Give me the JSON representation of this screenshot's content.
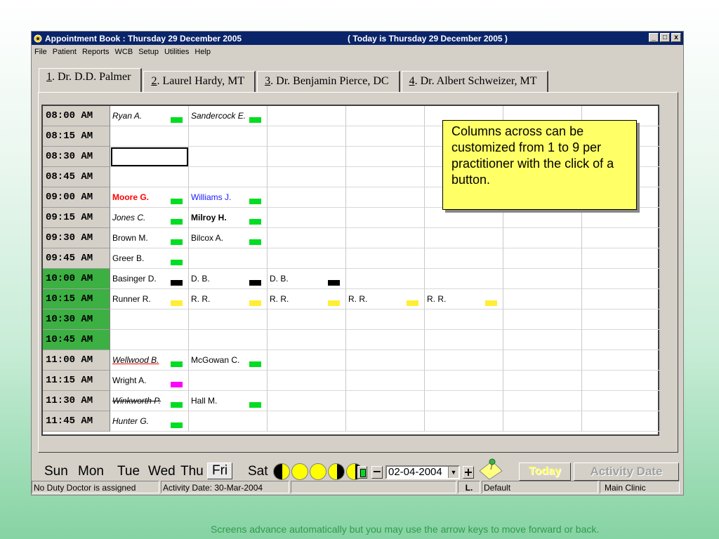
{
  "window": {
    "title": "Appointment Book : Thursday 29 December 2005",
    "today_label": "( Today is Thursday 29 December 2005 )",
    "min_label": "_",
    "max_label": "□",
    "close_label": "x"
  },
  "menu": [
    "File",
    "Patient",
    "Reports",
    "WCB",
    "Setup",
    "Utilities",
    "Help"
  ],
  "tabs": [
    {
      "num": "1",
      "label": ". Dr. D.D. Palmer"
    },
    {
      "num": "2",
      "label": ". Laurel Hardy, MT"
    },
    {
      "num": "3",
      "label": ". Dr. Benjamin Pierce, DC"
    },
    {
      "num": "4",
      "label": ". Dr. Albert Schweizer, MT"
    }
  ],
  "times": [
    "08:00 AM",
    "08:15 AM",
    "08:30 AM",
    "08:45 AM",
    "09:00 AM",
    "09:15 AM",
    "09:30 AM",
    "09:45 AM",
    "10:00 AM",
    "10:15 AM",
    "10:30 AM",
    "10:45 AM",
    "11:00 AM",
    "11:15 AM",
    "11:30 AM",
    "11:45 AM"
  ],
  "appointments": {
    "r0": [
      "Ryan A.",
      "Sandercock E."
    ],
    "r4": [
      "Moore G.",
      "Williams J."
    ],
    "r5": [
      "Jones C.",
      "Milroy H."
    ],
    "r6": [
      "Brown M.",
      "Bilcox A."
    ],
    "r7": [
      "Greer B."
    ],
    "r8": [
      "Basinger D.",
      "D. B.",
      "D. B."
    ],
    "r9": [
      "Runner R.",
      "R. R.",
      "R. R.",
      "R. R.",
      "R. R."
    ],
    "r12": [
      "Wellwood B.",
      "McGowan C."
    ],
    "r13": [
      "Wright A."
    ],
    "r14": [
      "Winkworth P.",
      "Hall M."
    ],
    "r15": [
      "Hunter G."
    ]
  },
  "colors": {
    "green": "#00dd22",
    "black": "#000000",
    "yellow": "#ffee33",
    "magenta": "#ff00ff",
    "time_green": "#3cb043"
  },
  "callout": "Columns across can be customized from 1 to 9 per practitioner with the click of a button.",
  "days": {
    "sun": "Sun",
    "mon": "Mon",
    "tue": "Tue",
    "wed": "Wed",
    "thu": "Thu",
    "fri": "Fri",
    "sat": "Sat"
  },
  "date_picker": {
    "value": "02-04-2004",
    "minus": "−",
    "plus": "+"
  },
  "buttons": {
    "today": "Today",
    "activity_date": "Activity Date"
  },
  "status": {
    "duty": "No Duty Doctor is assigned",
    "activity": "Activity Date: 30-Mar-2004",
    "blank": "",
    "l": "L.",
    "default": "Default",
    "clinic": "Main Clinic"
  },
  "footer": "Screens advance automatically but you may use the arrow keys to move forward or back."
}
